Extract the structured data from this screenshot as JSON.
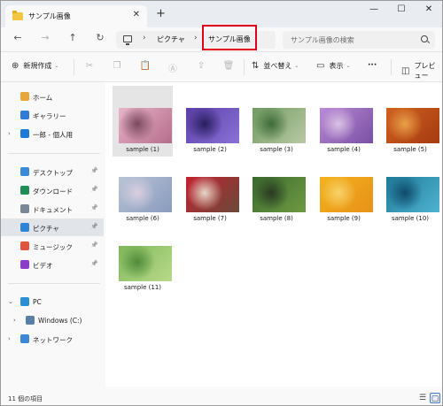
{
  "window": {
    "tab_title": "サンプル画像",
    "tab_close_glyph": "✕",
    "new_tab_glyph": "+",
    "minimize_glyph": "—",
    "maximize_glyph": "☐",
    "close_glyph": "✕"
  },
  "nav": {
    "back_glyph": "←",
    "forward_glyph": "→",
    "up_glyph": "↑",
    "refresh_glyph": "↻",
    "breadcrumb": [
      "ピクチャ",
      "サンプル画像"
    ],
    "separator": "›",
    "search_placeholder": "サンプル画像の検索"
  },
  "toolbar": {
    "new_label": "新規作成",
    "new_glyph": "⊕",
    "cut_glyph": "✂",
    "copy_glyph": "❐",
    "paste_glyph": "📋",
    "rename_glyph": "Ⓐ",
    "share_glyph": "⇪",
    "delete_glyph": "🗑",
    "sort_label": "並べ替え",
    "sort_glyph": "⇅",
    "view_label": "表示",
    "view_glyph": "▭",
    "more_glyph": "···",
    "preview_label": "プレビュー",
    "preview_glyph": "◫",
    "caret": "⌄"
  },
  "sidebar": {
    "items": [
      {
        "label": "ホーム",
        "icon": "home-icon",
        "color": "#e8a53a"
      },
      {
        "label": "ギャラリー",
        "icon": "gallery-icon",
        "color": "#2f7bd5"
      },
      {
        "label": "一郎 - 個人用",
        "icon": "onedrive-icon",
        "color": "#1d7ad6"
      },
      {
        "label": "デスクトップ",
        "icon": "desktop-icon",
        "color": "#3b8ad8"
      },
      {
        "label": "ダウンロード",
        "icon": "download-icon",
        "color": "#1f8f55"
      },
      {
        "label": "ドキュメント",
        "icon": "documents-icon",
        "color": "#7a8796"
      },
      {
        "label": "ピクチャ",
        "icon": "pictures-icon",
        "color": "#2c84d8"
      },
      {
        "label": "ミュージック",
        "icon": "music-icon",
        "color": "#e0533c"
      },
      {
        "label": "ビデオ",
        "icon": "videos-icon",
        "color": "#8a3ec9"
      },
      {
        "label": "PC",
        "icon": "pc-icon",
        "color": "#2a8fd6"
      },
      {
        "label": "Windows (C:)",
        "icon": "drive-icon",
        "color": "#5a7fa6"
      },
      {
        "label": "ネットワーク",
        "icon": "network-icon",
        "color": "#3c88d4"
      }
    ],
    "pin_glyph": "📌",
    "chev_right": "›",
    "chev_down": "⌄"
  },
  "files": [
    {
      "name": "sample (1)",
      "colors": [
        "#e8b5c9",
        "#b56d8b",
        "#7a4a5e"
      ]
    },
    {
      "name": "sample (2)",
      "colors": [
        "#5a3fa8",
        "#8a72d8",
        "#2a1f5e"
      ]
    },
    {
      "name": "sample (3)",
      "colors": [
        "#6f9a5e",
        "#b9c9a6",
        "#3f6a3a"
      ]
    },
    {
      "name": "sample (4)",
      "colors": [
        "#b98ad6",
        "#7a4fa3",
        "#d9c3e3"
      ]
    },
    {
      "name": "sample (5)",
      "colors": [
        "#d0621f",
        "#a63a12",
        "#e8a14a"
      ]
    },
    {
      "name": "sample (6)",
      "colors": [
        "#b9c3d6",
        "#8a9bbd",
        "#d9cfdf"
      ]
    },
    {
      "name": "sample (7)",
      "colors": [
        "#c4202f",
        "#6a4a3a",
        "#e8d6c9"
      ]
    },
    {
      "name": "sample (8)",
      "colors": [
        "#3a6a2e",
        "#6f9a42",
        "#2a3a22"
      ]
    },
    {
      "name": "sample (9)",
      "colors": [
        "#f2b21c",
        "#e8911a",
        "#f7d36a"
      ]
    },
    {
      "name": "sample (10)",
      "colors": [
        "#1f7a9a",
        "#4fb3d0",
        "#0f4a6a"
      ]
    },
    {
      "name": "sample (11)",
      "colors": [
        "#7fb85a",
        "#b9d98a",
        "#4f8a3a"
      ]
    }
  ],
  "status": {
    "item_count": "11 個の項目",
    "details_view_glyph": "☰",
    "tiles_view_glyph": "▢"
  }
}
